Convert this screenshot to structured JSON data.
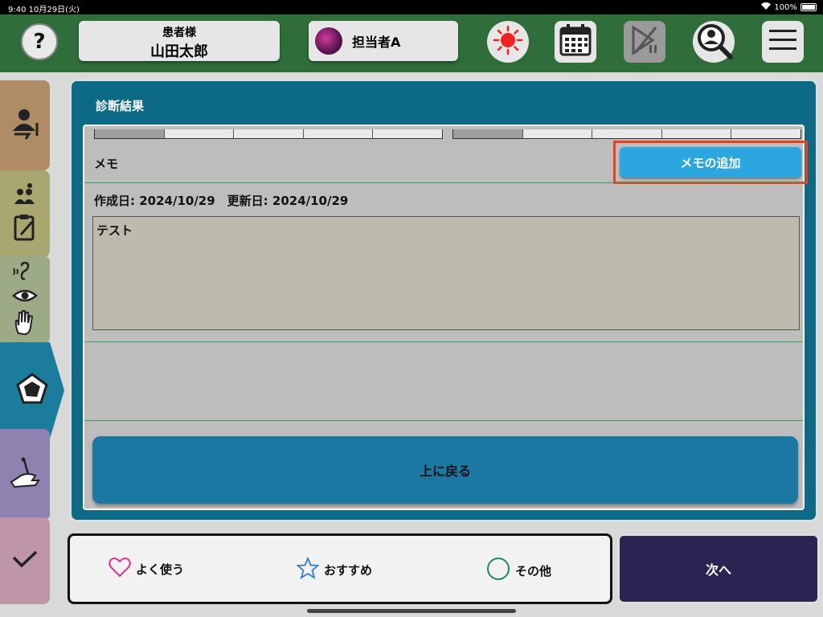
{
  "status_bar": {
    "time": "9:40 10月29日(火)",
    "battery": "100%"
  },
  "header": {
    "help_label": "?",
    "patient_label": "患者様",
    "patient_name": "山田太郎",
    "staff_name": "担当者A"
  },
  "panel": {
    "title": "診断結果",
    "memo_label": "メモ",
    "add_memo_button": "メモの追加",
    "dates": "作成日: 2024/10/29　更新日: 2024/10/29",
    "memo_text": "テスト",
    "back_button": "上に戻る"
  },
  "bottom": {
    "favorite": "よく使う",
    "recommended": "おすすめ",
    "other": "その他",
    "next_button": "次へ"
  },
  "colors": {
    "header_bg": "#2f6d3a",
    "panel_bg": "#0d6a87",
    "accent_button": "#2ba6df",
    "highlight_border": "#e8411e",
    "next_button_bg": "#2a2452"
  }
}
